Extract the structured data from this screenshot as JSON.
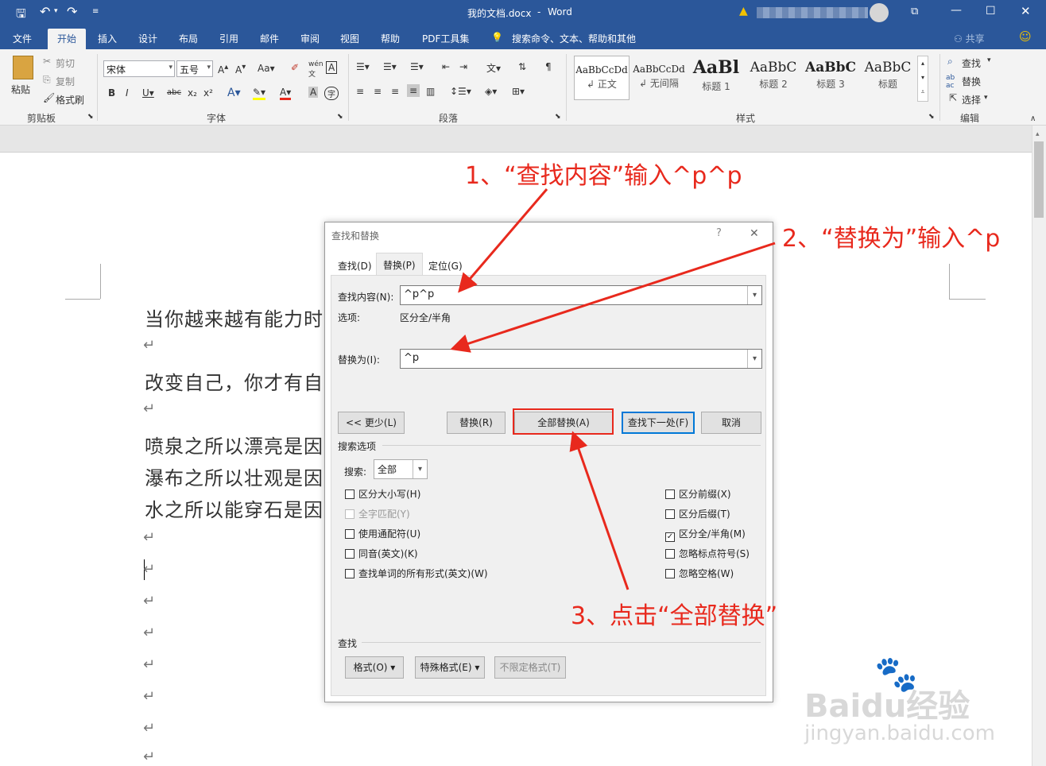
{
  "titlebar": {
    "doc_title": "我的文档.docx",
    "separator": "-",
    "app_name": "Word"
  },
  "tabs": [
    "文件",
    "开始",
    "插入",
    "设计",
    "布局",
    "引用",
    "邮件",
    "审阅",
    "视图",
    "帮助",
    "PDF工具集"
  ],
  "tell_me": "搜索命令、文本、帮助和其他",
  "share": "共享",
  "ribbon": {
    "clipboard": {
      "paste": "粘贴",
      "cut": "剪切",
      "copy": "复制",
      "format_painter": "格式刷",
      "label": "剪贴板"
    },
    "font": {
      "name": "宋体",
      "size": "五号",
      "label": "字体"
    },
    "paragraph": {
      "label": "段落"
    },
    "styles": {
      "label": "样式",
      "items": [
        {
          "preview": "AaBbCcDd",
          "name": "正文"
        },
        {
          "preview": "AaBbCcDd",
          "name": "无间隔"
        },
        {
          "preview": "AaBl",
          "name": "标题 1"
        },
        {
          "preview": "AaBbC",
          "name": "标题 2"
        },
        {
          "preview": "AaBbC",
          "name": "标题 3"
        },
        {
          "preview": "AaBbC",
          "name": "标题"
        }
      ]
    },
    "editing": {
      "find": "查找",
      "replace": "替换",
      "select": "选择",
      "label": "编辑"
    }
  },
  "document": {
    "lines": [
      "当你越来越有能力时",
      "改变自己，你才有自",
      "喷泉之所以漂亮是因",
      "瀑布之所以壮观是因",
      "水之所以能穿石是因"
    ],
    "para_mark": "↵"
  },
  "dialog": {
    "title": "查找和替换",
    "help": "?",
    "close": "✕",
    "tabs": [
      "查找(D)",
      "替换(P)",
      "定位(G)"
    ],
    "find_label": "查找内容(N):",
    "find_value": "^p^p",
    "options_label": "选项:",
    "options_value": "区分全/半角",
    "replace_label": "替换为(I):",
    "replace_value": "^p",
    "buttons": {
      "less": "<< 更少(L)",
      "replace": "替换(R)",
      "replace_all": "全部替换(A)",
      "find_next": "查找下一处(F)",
      "cancel": "取消"
    },
    "search_options_label": "搜索选项",
    "search_label": "搜索:",
    "search_value": "全部",
    "checkboxes_left": [
      {
        "label": "区分大小写(H)",
        "checked": false,
        "disabled": false
      },
      {
        "label": "全字匹配(Y)",
        "checked": false,
        "disabled": true
      },
      {
        "label": "使用通配符(U)",
        "checked": false,
        "disabled": false
      },
      {
        "label": "同音(英文)(K)",
        "checked": false,
        "disabled": false
      },
      {
        "label": "查找单词的所有形式(英文)(W)",
        "checked": false,
        "disabled": false
      }
    ],
    "checkboxes_right": [
      {
        "label": "区分前缀(X)",
        "checked": false
      },
      {
        "label": "区分后缀(T)",
        "checked": false
      },
      {
        "label": "区分全/半角(M)",
        "checked": true
      },
      {
        "label": "忽略标点符号(S)",
        "checked": false
      },
      {
        "label": "忽略空格(W)",
        "checked": false
      }
    ],
    "find_section_label": "查找",
    "format_buttons": {
      "format": "格式(O) ▾",
      "special": "特殊格式(E) ▾",
      "no_format": "不限定格式(T)"
    }
  },
  "annotations": {
    "step1": "1、“查找内容”输入^p^p",
    "step2": "2、“替换为”输入^p",
    "step3": "3、点击“全部替换”"
  },
  "watermark": {
    "brand": "Baidu经验",
    "url": "jingyan.baidu.com"
  },
  "colors": {
    "ribbon_blue": "#2b579a",
    "annotation_red": "#e8291d",
    "button_focus_blue": "#0078d7"
  }
}
